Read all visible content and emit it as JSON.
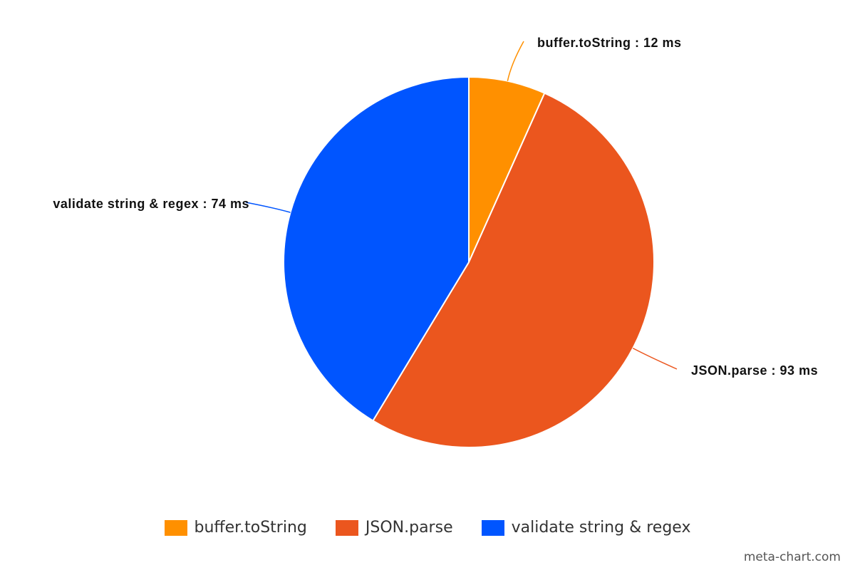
{
  "chart_data": {
    "type": "pie",
    "title": "",
    "unit": "ms",
    "slices": [
      {
        "name": "buffer.toString",
        "value": 12,
        "color": "#FF9000",
        "label": "buffer.toString : 12 ms"
      },
      {
        "name": "JSON.parse",
        "value": 93,
        "color": "#EB561E",
        "label": "JSON.parse : 93 ms"
      },
      {
        "name": "validate string & regex",
        "value": 74,
        "color": "#0055FF",
        "label": "validate string & regex : 74 ms"
      }
    ],
    "legend_position": "bottom"
  },
  "watermark": "meta-chart.com"
}
